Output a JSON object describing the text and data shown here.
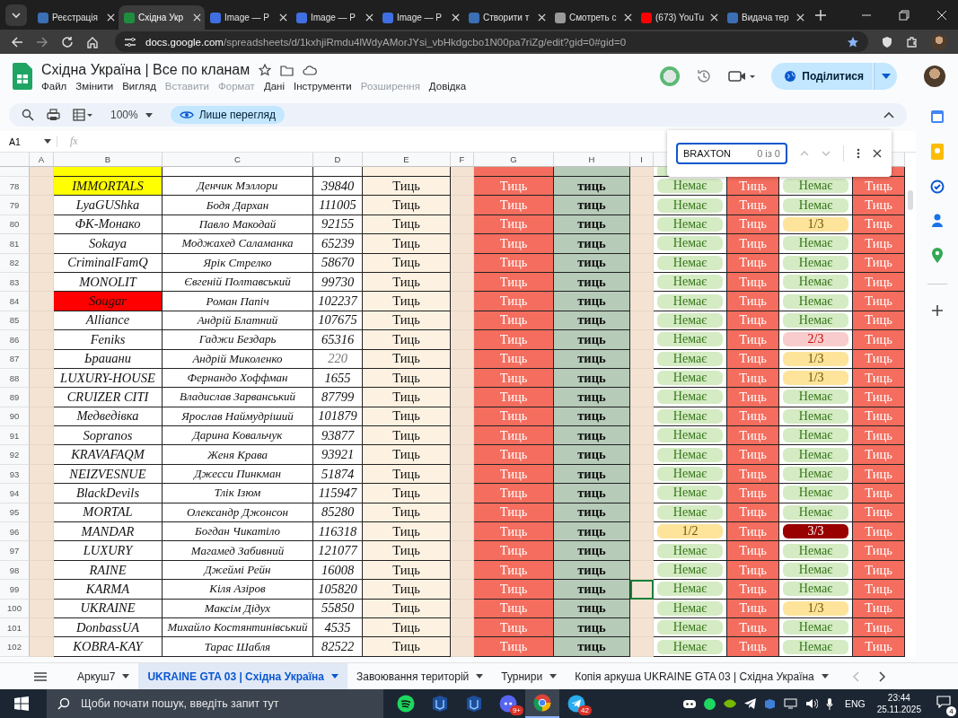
{
  "browser": {
    "tabs": [
      {
        "label": "Реєстрація",
        "selected": false,
        "color": "#3b6fb6"
      },
      {
        "label": "Східна Укр",
        "selected": true,
        "color": "#1e8e3e"
      },
      {
        "label": "Image — P",
        "selected": false,
        "color": "#3f6fe0"
      },
      {
        "label": "Image — P",
        "selected": false,
        "color": "#3f6fe0"
      },
      {
        "label": "Image — P",
        "selected": false,
        "color": "#3f6fe0"
      },
      {
        "label": "Створити т",
        "selected": false,
        "color": "#3b6fb6"
      },
      {
        "label": "Смотреть с",
        "selected": false,
        "color": "#9a9a9a"
      },
      {
        "label": "(673) YouTu",
        "selected": false,
        "color": "#ff0000"
      },
      {
        "label": "Видача тер",
        "selected": false,
        "color": "#3b6fb6"
      }
    ],
    "host": "docs.google.com",
    "path": "/spreadsheets/d/1kxhjiRmdu4lWdyAMorJYsi_vbHkdgcbo1N00pa7riZg/edit?gid=0#gid=0"
  },
  "doc": {
    "title": "Східна Україна | Все по кланам",
    "share": "Поділитися",
    "menu": [
      {
        "label": "Файл",
        "disabled": false
      },
      {
        "label": "Змінити",
        "disabled": false
      },
      {
        "label": "Вигляд",
        "disabled": false
      },
      {
        "label": "Вставити",
        "disabled": true
      },
      {
        "label": "Формат",
        "disabled": true
      },
      {
        "label": "Дані",
        "disabled": false
      },
      {
        "label": "Інструменти",
        "disabled": false
      },
      {
        "label": "Розширення",
        "disabled": true
      },
      {
        "label": "Довідка",
        "disabled": false
      }
    ]
  },
  "toolbar": {
    "zoom": "100%",
    "mode": "Лише перегляд"
  },
  "formula_bar": {
    "cell": "A1",
    "fx": "fx"
  },
  "find": {
    "value": "BRAXTON",
    "count": "0 із 0"
  },
  "columns": [
    "A",
    "B",
    "C",
    "D",
    "E",
    "F",
    "G",
    "H",
    "I"
  ],
  "rows": [
    {
      "partial": true,
      "selected": false,
      "color": "#ffff00",
      "j": {
        "kind": "none"
      },
      "l": {
        "kind": "none"
      }
    },
    {
      "n": "78",
      "selected": false,
      "clan": "IMMORTALS",
      "color": "#ffff00",
      "leader": "Денчик Мэллори",
      "score": "39840",
      "e": "Тиць",
      "g": "Тиць",
      "h": "тиць",
      "j": {
        "text": "Немає",
        "kind": "none"
      },
      "k": "Тиць",
      "l": {
        "text": "Немає",
        "kind": "none"
      },
      "m": "Тиць"
    },
    {
      "n": "79",
      "selected": false,
      "clan": "LyaGUShka",
      "leader": "Бодя Дархан",
      "score": "111005",
      "e": "Тиць",
      "g": "Тиць",
      "h": "тиць",
      "j": {
        "text": "Немає",
        "kind": "none"
      },
      "k": "Тиць",
      "l": {
        "text": "Немає",
        "kind": "none"
      },
      "m": "Тиць"
    },
    {
      "n": "80",
      "selected": false,
      "clan": "ФК-Монако",
      "leader": "Павло Макодай",
      "score": "92155",
      "e": "Тиць",
      "g": "Тиць",
      "h": "тиць",
      "j": {
        "text": "Немає",
        "kind": "none"
      },
      "k": "Тиць",
      "l": {
        "text": "1/3",
        "kind": "low"
      },
      "m": "Тиць"
    },
    {
      "n": "81",
      "selected": false,
      "clan": "Sokaya",
      "leader": "Моджахед Саламанка",
      "score": "65239",
      "e": "Тиць",
      "g": "Тиць",
      "h": "тиць",
      "j": {
        "text": "Немає",
        "kind": "none"
      },
      "k": "Тиць",
      "l": {
        "text": "Немає",
        "kind": "none"
      },
      "m": "Тиць"
    },
    {
      "n": "82",
      "selected": false,
      "clan": "CriminalFamQ",
      "leader": "Ярік Стрелко",
      "score": "58670",
      "e": "Тиць",
      "g": "Тиць",
      "h": "тиць",
      "j": {
        "text": "Немає",
        "kind": "none"
      },
      "k": "Тиць",
      "l": {
        "text": "Немає",
        "kind": "none"
      },
      "m": "Тиць"
    },
    {
      "n": "83",
      "selected": false,
      "clan": "MONOLIT",
      "leader": "Євгеній Полтавський",
      "score": "99730",
      "e": "Тиць",
      "g": "Тиць",
      "h": "тиць",
      "j": {
        "text": "Немає",
        "kind": "none"
      },
      "k": "Тиць",
      "l": {
        "text": "Немає",
        "kind": "none"
      },
      "m": "Тиць"
    },
    {
      "n": "84",
      "selected": false,
      "clan": "Sougar",
      "color": "#ff0000",
      "leader": "Роман Папіч",
      "score": "102237",
      "e": "Тиць",
      "g": "Тиць",
      "h": "тиць",
      "j": {
        "text": "Немає",
        "kind": "none"
      },
      "k": "Тиць",
      "l": {
        "text": "Немає",
        "kind": "none"
      },
      "m": "Тиць"
    },
    {
      "n": "85",
      "selected": false,
      "clan": "Alliance",
      "leader": "Андрій Блатний",
      "score": "107675",
      "e": "Тиць",
      "g": "Тиць",
      "h": "тиць",
      "j": {
        "text": "Немає",
        "kind": "none"
      },
      "k": "Тиць",
      "l": {
        "text": "Немає",
        "kind": "none"
      },
      "m": "Тиць"
    },
    {
      "n": "86",
      "selected": false,
      "clan": "Feniks",
      "leader": "Гаджи Бездарь",
      "score": "65316",
      "e": "Тиць",
      "g": "Тиць",
      "h": "тиць",
      "j": {
        "text": "Немає",
        "kind": "none"
      },
      "k": "Тиць",
      "l": {
        "text": "2/3",
        "kind": "mid"
      },
      "m": "Тиць"
    },
    {
      "n": "87",
      "selected": false,
      "clan": "Ьраиани",
      "leader": "Андрій Миколенко",
      "score": "220",
      "dim": true,
      "e": "Тиць",
      "g": "Тиць",
      "h": "тиць",
      "j": {
        "text": "Немає",
        "kind": "none"
      },
      "k": "Тиць",
      "l": {
        "text": "1/3",
        "kind": "low"
      },
      "m": "Тиць"
    },
    {
      "n": "88",
      "selected": false,
      "clan": "LUXURY-HOUSE",
      "leader": "Фернандо Хоффман",
      "score": "1655",
      "e": "Тиць",
      "g": "Тиць",
      "h": "тиць",
      "j": {
        "text": "Немає",
        "kind": "none"
      },
      "k": "Тиць",
      "l": {
        "text": "1/3",
        "kind": "low"
      },
      "m": "Тиць"
    },
    {
      "n": "89",
      "selected": false,
      "clan": "CRUIZER CITI",
      "leader": "Владислав Зарванський",
      "score": "87799",
      "e": "Тиць",
      "g": "Тиць",
      "h": "тиць",
      "j": {
        "text": "Немає",
        "kind": "none"
      },
      "k": "Тиць",
      "l": {
        "text": "Немає",
        "kind": "none"
      },
      "m": "Тиць"
    },
    {
      "n": "90",
      "selected": false,
      "clan": "Медведівка",
      "leader": "Ярослав Наймудріший",
      "score": "101879",
      "e": "Тиць",
      "g": "Тиць",
      "h": "тиць",
      "j": {
        "text": "Немає",
        "kind": "none"
      },
      "k": "Тиць",
      "l": {
        "text": "Немає",
        "kind": "none"
      },
      "m": "Тиць"
    },
    {
      "n": "91",
      "selected": false,
      "clan": "Sopranos",
      "leader": "Дарина Ковальчук",
      "score": "93877",
      "e": "Тиць",
      "g": "Тиць",
      "h": "тиць",
      "j": {
        "text": "Немає",
        "kind": "none"
      },
      "k": "Тиць",
      "l": {
        "text": "Немає",
        "kind": "none"
      },
      "m": "Тиць"
    },
    {
      "n": "92",
      "selected": false,
      "clan": "KRAVAFAQM",
      "leader": "Женя Крава",
      "score": "93921",
      "e": "Тиць",
      "g": "Тиць",
      "h": "тиць",
      "j": {
        "text": "Немає",
        "kind": "none"
      },
      "k": "Тиць",
      "l": {
        "text": "Немає",
        "kind": "none"
      },
      "m": "Тиць"
    },
    {
      "n": "93",
      "selected": false,
      "clan": "NEIZVESNUE",
      "leader": "Джесси Пинкман",
      "score": "51874",
      "e": "Тиць",
      "g": "Тиць",
      "h": "тиць",
      "j": {
        "text": "Немає",
        "kind": "none"
      },
      "k": "Тиць",
      "l": {
        "text": "Немає",
        "kind": "none"
      },
      "m": "Тиць"
    },
    {
      "n": "94",
      "selected": false,
      "clan": "BlackDevils",
      "leader": "Тлік Ізюм",
      "score": "115947",
      "e": "Тиць",
      "g": "Тиць",
      "h": "тиць",
      "j": {
        "text": "Немає",
        "kind": "none"
      },
      "k": "Тиць",
      "l": {
        "text": "Немає",
        "kind": "none"
      },
      "m": "Тиць"
    },
    {
      "n": "95",
      "selected": false,
      "clan": "MORTAL",
      "leader": "Олександр Джонсон",
      "score": "85280",
      "e": "Тиць",
      "g": "Тиць",
      "h": "тиць",
      "j": {
        "text": "Немає",
        "kind": "none"
      },
      "k": "Тиць",
      "l": {
        "text": "Немає",
        "kind": "none"
      },
      "m": "Тиць"
    },
    {
      "n": "96",
      "selected": false,
      "clan": "MANDAR",
      "leader": "Богдан Чикатіло",
      "score": "116318",
      "e": "Тиць",
      "g": "Тиць",
      "h": "тиць",
      "j": {
        "text": "1/2",
        "kind": "low"
      },
      "k": "Тиць",
      "l": {
        "text": "3/3",
        "kind": "high"
      },
      "m": "Тиць"
    },
    {
      "n": "97",
      "selected": false,
      "clan": "LUXURY",
      "leader": "Магамед Забивний",
      "score": "121077",
      "e": "Тиць",
      "g": "Тиць",
      "h": "тиць",
      "j": {
        "text": "Немає",
        "kind": "none"
      },
      "k": "Тиць",
      "l": {
        "text": "Немає",
        "kind": "none"
      },
      "m": "Тиць"
    },
    {
      "n": "98",
      "selected": false,
      "clan": "RAINE",
      "leader": "Джеймі Рейн",
      "score": "16008",
      "e": "Тиць",
      "g": "Тиць",
      "h": "тиць",
      "j": {
        "text": "Немає",
        "kind": "none"
      },
      "k": "Тиць",
      "l": {
        "text": "Немає",
        "kind": "none"
      },
      "m": "Тиць"
    },
    {
      "n": "99",
      "selected": true,
      "clan": "KARMA",
      "leader": "Кіля Азіров",
      "score": "105820",
      "e": "Тиць",
      "g": "Тиць",
      "h": "тиць",
      "j": {
        "text": "Немає",
        "kind": "none"
      },
      "k": "Тиць",
      "l": {
        "text": "Немає",
        "kind": "none"
      },
      "m": "Тиць"
    },
    {
      "n": "100",
      "selected": false,
      "clan": "UKRAINE",
      "leader": "Максім Дідух",
      "score": "55850",
      "e": "Тиць",
      "g": "Тиць",
      "h": "тиць",
      "j": {
        "text": "Немає",
        "kind": "none"
      },
      "k": "Тиць",
      "l": {
        "text": "1/3",
        "kind": "low"
      },
      "m": "Тиць"
    },
    {
      "n": "101",
      "selected": false,
      "clan": "DonbassUA",
      "leader": "Михайло Костянтинівський",
      "score": "4535",
      "e": "Тиць",
      "g": "Тиць",
      "h": "тиць",
      "j": {
        "text": "Немає",
        "kind": "none"
      },
      "k": "Тиць",
      "l": {
        "text": "Немає",
        "kind": "none"
      },
      "m": "Тиць"
    },
    {
      "n": "102",
      "selected": false,
      "clan": "KOBRA-KAY",
      "leader": "Тарас Шабля",
      "score": "82522",
      "e": "Тиць",
      "g": "Тиць",
      "h": "тиць",
      "j": {
        "text": "Немає",
        "kind": "none"
      },
      "k": "Тиць",
      "l": {
        "text": "Немає",
        "kind": "none"
      },
      "m": "Тиць"
    }
  ],
  "sheet_tabs": [
    {
      "label": "Аркуш7",
      "selected": false
    },
    {
      "label": "UKRAINE GTA 03 | Східна Україна",
      "selected": true
    },
    {
      "label": "Завоювання територій",
      "selected": false
    },
    {
      "label": "Турнири",
      "selected": false
    },
    {
      "label": "Копія аркуша UKRAINE GTA 03 | Східна Україна",
      "selected": false
    }
  ],
  "taskbar": {
    "search_placeholder": "Щоби почати пошук, введіть запит тут",
    "apps": [
      {
        "kind": "spotify"
      },
      {
        "kind": "app"
      },
      {
        "kind": "app"
      },
      {
        "kind": "discord",
        "badge": "9+"
      },
      {
        "kind": "chrome"
      },
      {
        "kind": "telegram",
        "badge": "42"
      }
    ],
    "language": "ENG",
    "time": "23:44",
    "date": "25.11.2025",
    "notifications": "4"
  }
}
